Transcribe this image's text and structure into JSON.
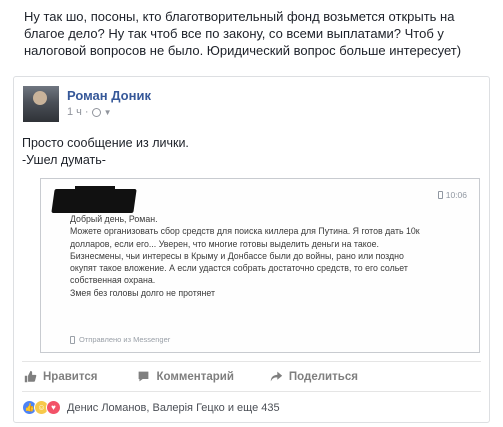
{
  "intro_text": "Ну так шо, посоны, кто благотворительный фонд возьмется открыть на благое дело? Ну так чтоб все по закону, со всеми выплатами? Чтоб у налоговой вопросов не было. Юридический вопрос больше интересует)",
  "post": {
    "author": "Роман Доник",
    "time": "1 ч",
    "text_line1": "Просто сообщение из лички.",
    "text_line2": "-Ушел думать-"
  },
  "screenshot": {
    "time": "10:06",
    "greeting": "Добрый день, Роман.",
    "body": "Можете организовать сбор средств для поиска киллера для Путина. Я готов дать 10к долларов, если его... Уверен, что многие готовы выделить деньги на такое. Бизнесмены, чьи интересы в Крыму и Донбассе были до войны, рано или поздно окупят такое вложение. А если удастся собрать достаточно средств, то его сольет собственная охрана.",
    "closing": "Змея без головы долго не протянет",
    "sent_via": "Отправлено из Messenger"
  },
  "actions": {
    "like": "Нравится",
    "comment": "Комментарий",
    "share": "Поделиться"
  },
  "reactions": {
    "text": "Денис Ломанов, Валерія Гецко и еще 435",
    "types": [
      "like-icon",
      "haha-icon",
      "love-icon"
    ]
  },
  "colors": {
    "author": "#365899",
    "muted": "#90949c",
    "like_reaction": "#4e84f5",
    "love_reaction": "#f25268"
  }
}
